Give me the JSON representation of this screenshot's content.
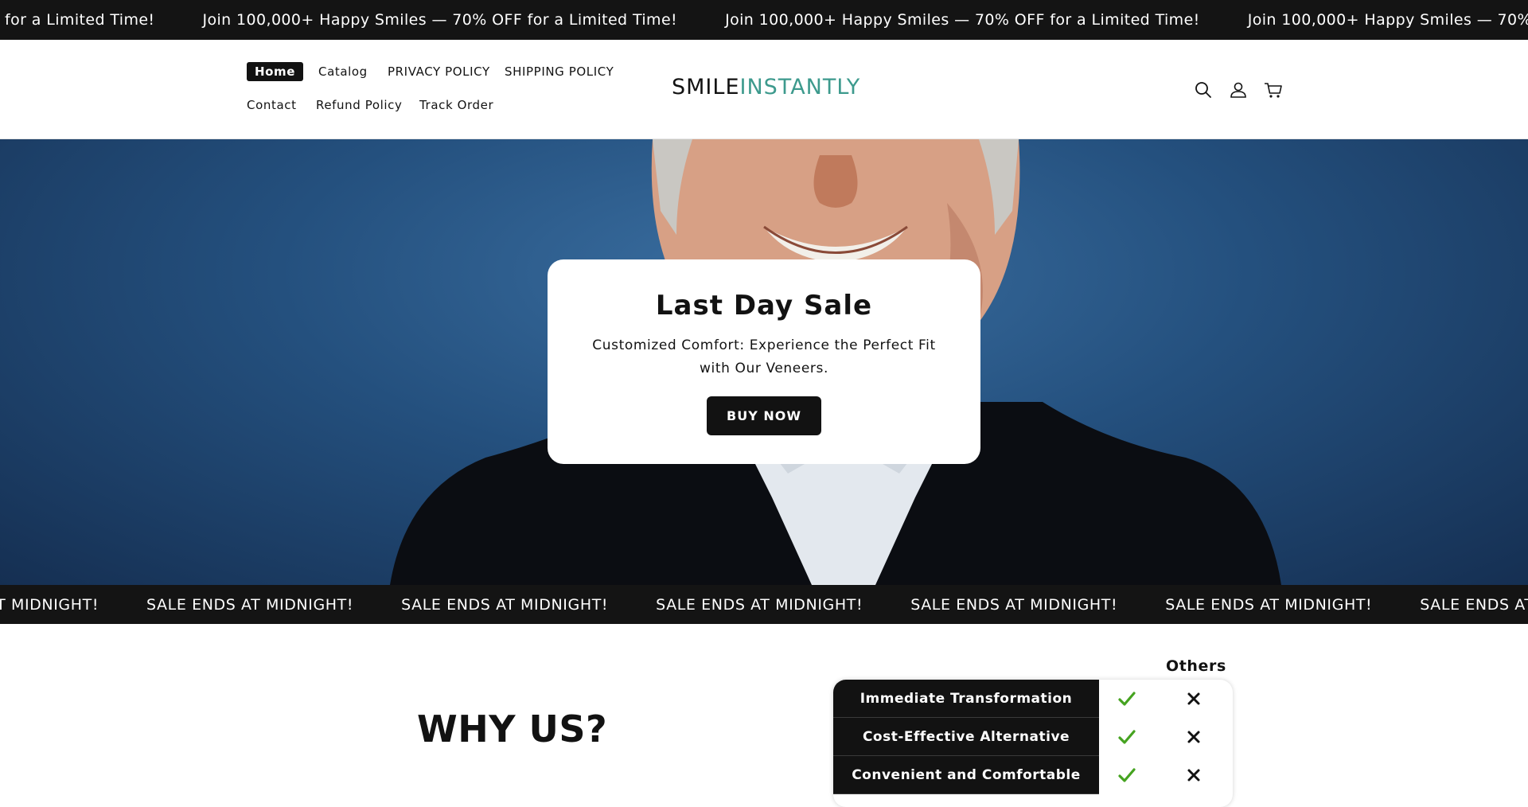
{
  "announcement": {
    "text": "Join 100,000+ Happy Smiles — 70% OFF for a Limited Time!",
    "partial_text": "for a Limited Time!"
  },
  "header": {
    "nav": [
      {
        "label": "Home",
        "active": true
      },
      {
        "label": "Catalog"
      },
      {
        "label": "PRIVACY POLICY"
      },
      {
        "label": "SHIPPING POLICY"
      },
      {
        "label": "Contact"
      },
      {
        "label": "Refund Policy"
      },
      {
        "label": "Track Order"
      }
    ],
    "logo": {
      "part1": "SMILE",
      "part2": "INSTANTLY"
    },
    "icons": [
      "search-icon",
      "account-icon",
      "cart-icon"
    ]
  },
  "hero": {
    "title": "Last Day Sale",
    "subtitle": "Customized Comfort: Experience the Perfect Fit with Our Veneers.",
    "button": "BUY NOW"
  },
  "sale_marquee": {
    "text": "SALE ENDS AT MIDNIGHT!"
  },
  "why_us": {
    "title": "WHY US?",
    "others_label": "Others",
    "rows": [
      {
        "feature": "Immediate Transformation",
        "us": true,
        "others": false
      },
      {
        "feature": "Cost-Effective Alternative",
        "us": true,
        "others": false
      },
      {
        "feature": "Convenient and Comfortable",
        "us": true,
        "others": false
      }
    ]
  },
  "colors": {
    "bar_bg": "#141414",
    "logo_teal": "#3d9a8d",
    "check_green": "#45a320",
    "hero_blue": "#24507e"
  }
}
